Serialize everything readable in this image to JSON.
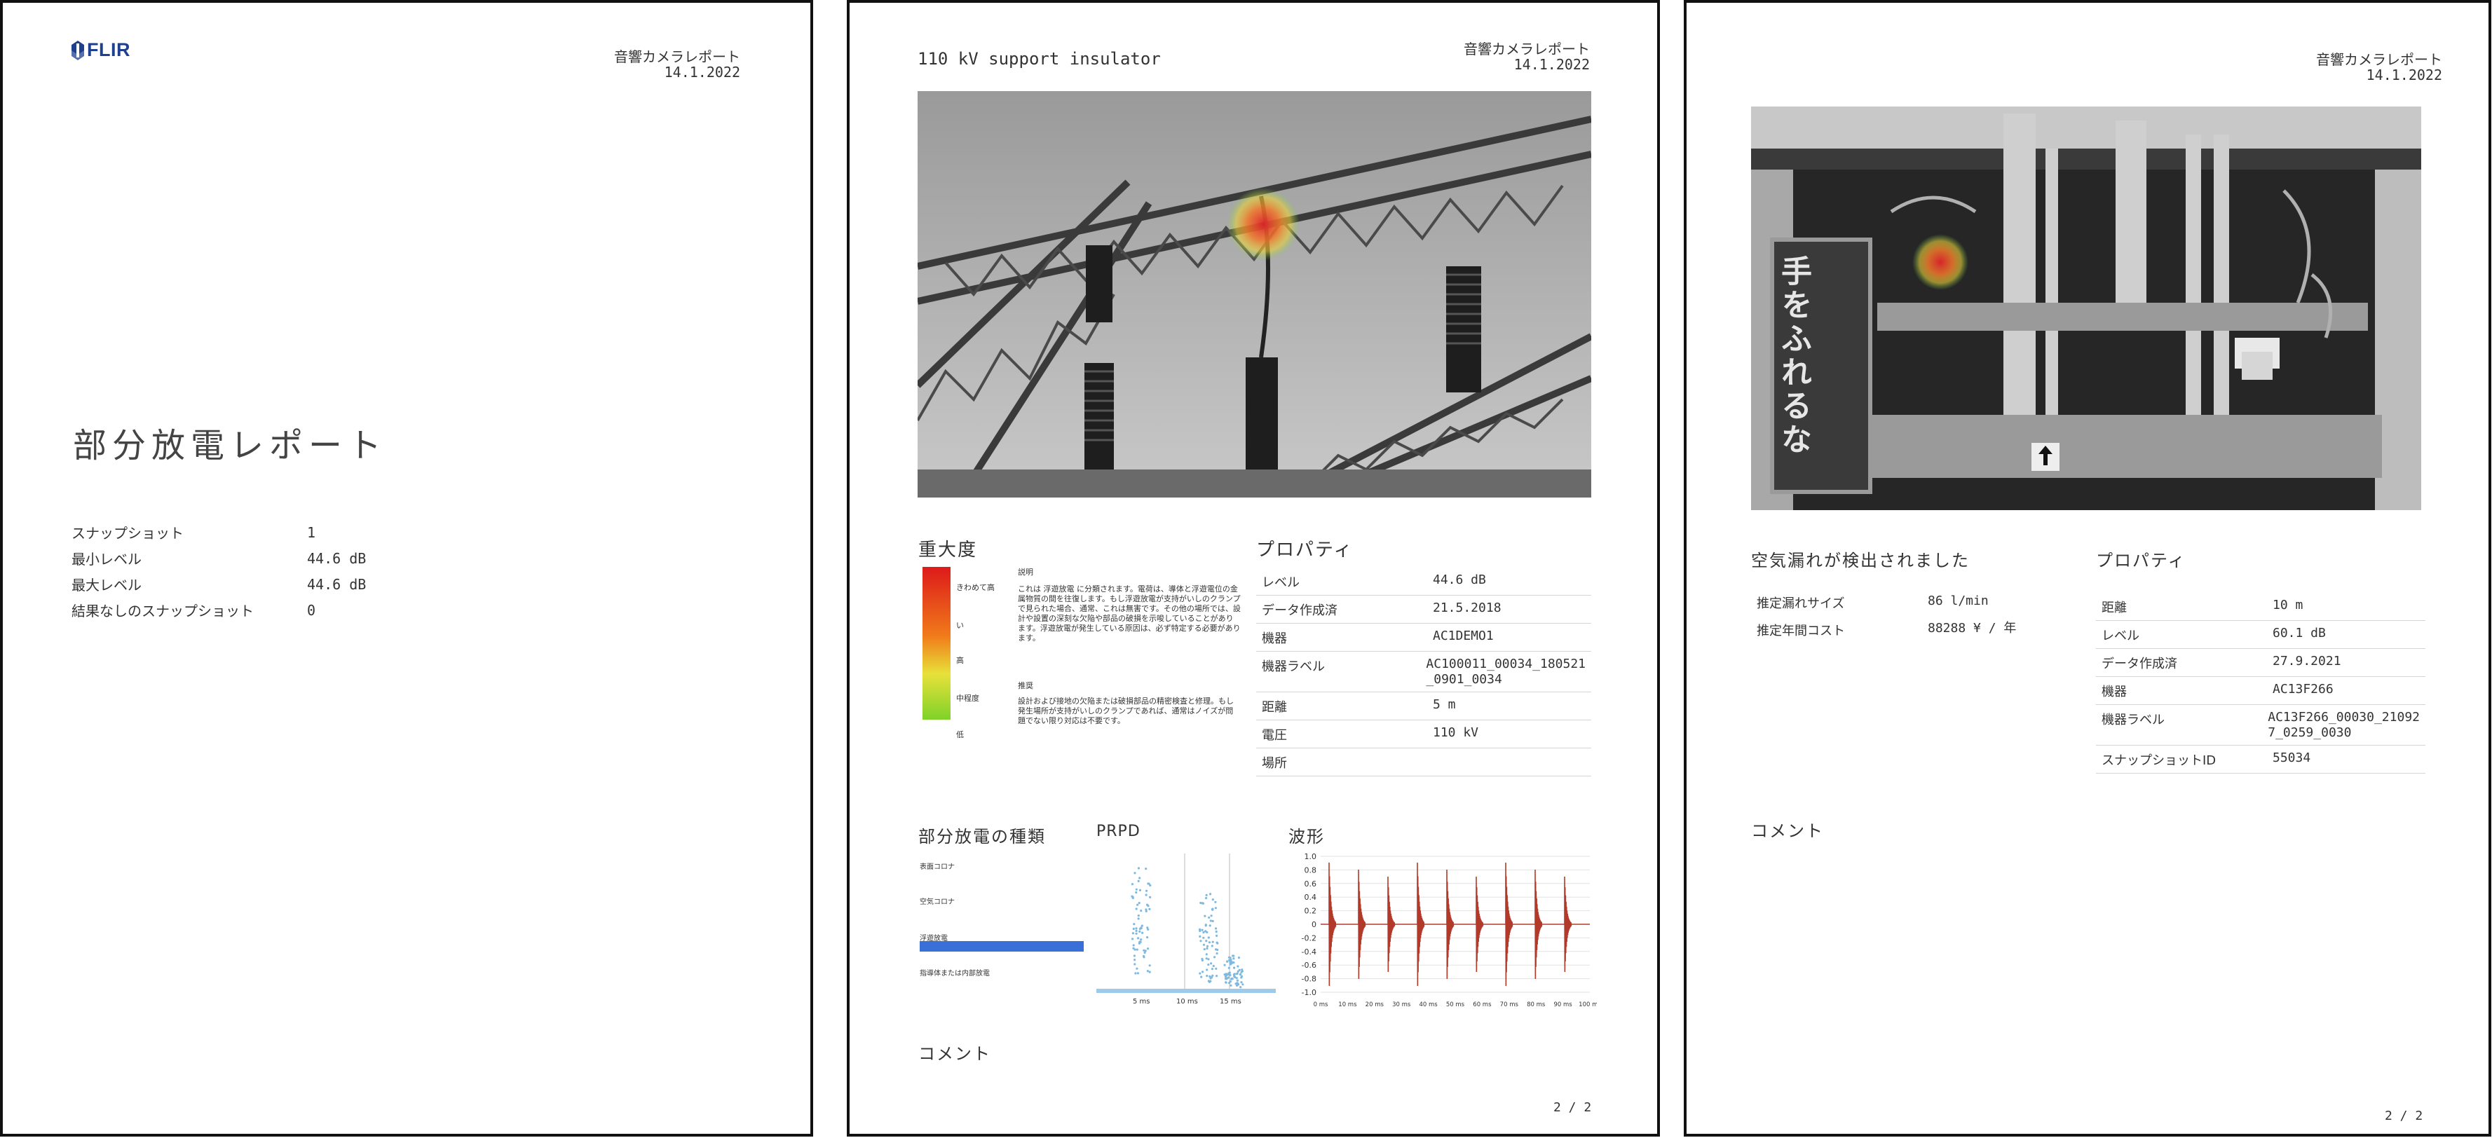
{
  "page1": {
    "logo_text": "FLIR",
    "header": {
      "title": "音響カメラレポート",
      "date": "14.1.2022"
    },
    "report_title": "部分放電レポート",
    "summary": [
      {
        "label": "スナップショット",
        "value": "1"
      },
      {
        "label": "最小レベル",
        "value": "44.6 dB"
      },
      {
        "label": "最大レベル",
        "value": "44.6 dB"
      },
      {
        "label": "結果なしのスナップショット",
        "value": "0"
      }
    ]
  },
  "page2": {
    "snapshot_title": "110 kV support insulator",
    "header": {
      "title": "音響カメラレポート",
      "date": "14.1.2022"
    },
    "severity": {
      "title": "重大度",
      "levels": [
        "きわめて高",
        "い",
        "高",
        "中程度",
        "低"
      ],
      "description_heading": "説明",
      "description_text": "これは 浮遊放電 に分類されます。電荷は、導体と浮遊電位の金属物質の間を往復します。もし浮遊放電が支持がいしのクランプで見られた場合、通常、これは無害です。その他の場所では、設計や設置の深刻な欠陥や部品の破損を示唆していることがあります。浮遊放電が発生している原因は、必ず特定する必要があります。",
      "recommendation_heading": "推奨",
      "recommendation_text": "設計および接地の欠陥または破損部品の精密検査と修理。もし発生場所が支持がいしのクランプであれば、通常はノイズが問題でない限り対応は不要です。"
    },
    "properties": {
      "title": "プロパティ",
      "rows": [
        {
          "label": "レベル",
          "value": "44.6 dB"
        },
        {
          "label": "データ作成済",
          "value": "21.5.2018"
        },
        {
          "label": "機器",
          "value": "AC1DEMO1"
        },
        {
          "label": "機器ラベル",
          "value": "AC100011_00034_180521\n_0901_0034"
        },
        {
          "label": "距離",
          "value": "5 m"
        },
        {
          "label": "電圧",
          "value": "110 kV"
        },
        {
          "label": "場所",
          "value": ""
        }
      ]
    },
    "pd_types": {
      "title": "部分放電の種類",
      "labels": [
        "表面コロナ",
        "空気コロナ",
        "浮遊放電",
        "指導体または内部放電"
      ],
      "highlight_color": "#3b6fd8"
    },
    "prpd": {
      "title": "PRPD",
      "x_ticks": [
        "5 ms",
        "10 ms",
        "15 ms"
      ]
    },
    "waveform": {
      "title": "波形",
      "y_ticks": [
        "1.0",
        "0.8",
        "0.6",
        "0.4",
        "0.2",
        "0",
        "-0.2",
        "-0.4",
        "-0.6",
        "-0.8",
        "-1.0"
      ],
      "x_ticks": [
        "0 ms",
        "10 ms",
        "20 ms",
        "30 ms",
        "40 ms",
        "50 ms",
        "60 ms",
        "70 ms",
        "80 ms",
        "90 ms",
        "100 ms"
      ],
      "color": "#b23a2a"
    },
    "comment_title": "コメント",
    "page_number": "2 / 2"
  },
  "page3": {
    "header": {
      "title": "音響カメラレポート",
      "date": "14.1.2022"
    },
    "sign_text": "手をふれるな",
    "leak": {
      "title": "空気漏れが検出されました",
      "rows": [
        {
          "label": "推定漏れサイズ",
          "value": "86 l/min"
        },
        {
          "label": "推定年間コスト",
          "value": "88288 ¥ / 年"
        }
      ]
    },
    "properties": {
      "title": "プロパティ",
      "rows": [
        {
          "label": "距離",
          "value": "10 m"
        },
        {
          "label": "レベル",
          "value": "60.1 dB"
        },
        {
          "label": "データ作成済",
          "value": "27.9.2021"
        },
        {
          "label": "機器",
          "value": "AC13F266"
        },
        {
          "label": "機器ラベル",
          "value": "AC13F266_00030_21092\n7_0259_0030"
        },
        {
          "label": "スナップショットID",
          "value": "55034"
        }
      ]
    },
    "comment_title": "コメント",
    "page_number": "2 / 2"
  }
}
